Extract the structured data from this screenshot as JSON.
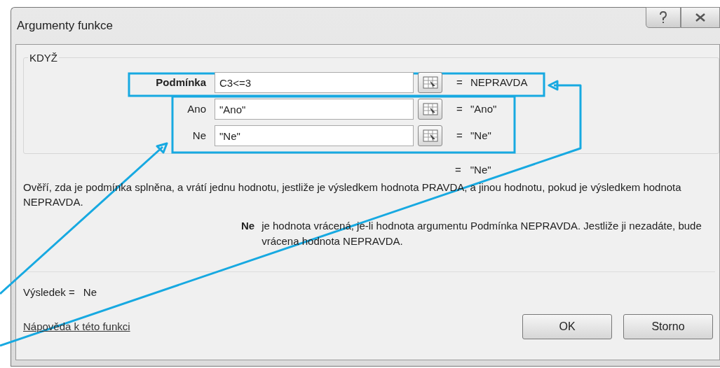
{
  "window": {
    "title": "Argumenty funkce"
  },
  "function_name": "KDYŽ",
  "arguments": [
    {
      "label": "Podmínka",
      "value": "C3<=3",
      "equals": "=",
      "result": "NEPRAVDA",
      "selected": true
    },
    {
      "label": "Ano",
      "value": "\"Ano\"",
      "equals": "=",
      "result": "\"Ano\"",
      "selected": false
    },
    {
      "label": "Ne",
      "value": "\"Ne\"",
      "equals": "=",
      "result": "\"Ne\"",
      "selected": false
    }
  ],
  "formula_result": {
    "equals": "=",
    "value": "\"Ne\""
  },
  "description": "Ověří, zda je podmínka splněna, a vrátí jednu hodnotu, jestliže je výsledkem hodnota PRAVDA, a jinou hodnotu, pokud je výsledkem hodnota NEPRAVDA.",
  "argument_help": {
    "name": "Ne",
    "text": "je hodnota vrácená, je-li hodnota argumentu Podmínka NEPRAVDA. Jestliže ji nezadáte, bude vrácena hodnota NEPRAVDA."
  },
  "result": {
    "label": "Výsledek =",
    "value": "Ne"
  },
  "help_link": "Nápověda k této funkci",
  "buttons": [
    "OK",
    "Storno"
  ]
}
